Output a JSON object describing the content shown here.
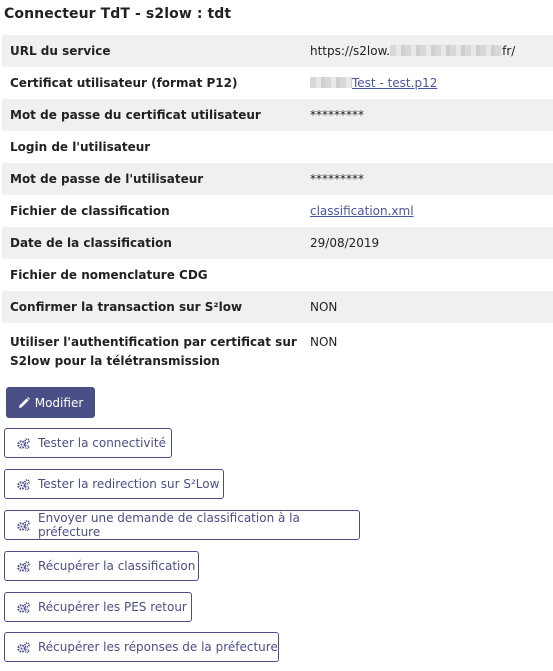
{
  "title": "Connecteur TdT - s2low : tdt",
  "rows": [
    {
      "label": "URL du service",
      "value_prefix": "https://s2low.",
      "value_suffix": "fr/"
    },
    {
      "label": "Certificat utilisateur (format P12)",
      "link": "Test - test.p12"
    },
    {
      "label": "Mot de passe du certificat utilisateur",
      "value": "*********"
    },
    {
      "label": "Login de l'utilisateur",
      "value": ""
    },
    {
      "label": "Mot de passe de l'utilisateur",
      "value": "*********"
    },
    {
      "label": "Fichier de classification",
      "link": "classification.xml"
    },
    {
      "label": "Date de la classification",
      "value": "29/08/2019"
    },
    {
      "label": "Fichier de nomenclature CDG",
      "value": ""
    },
    {
      "label": "Confirmer la transaction sur S²low",
      "value": "NON"
    },
    {
      "label": "Utiliser l'authentification par certificat sur S2low pour la télétransmission",
      "value": "NON"
    }
  ],
  "buttons": {
    "modifier": "Modifier",
    "tester_connectivite": "Tester la connectivité",
    "tester_redirection": "Tester la redirection sur S²Low",
    "envoyer_classification": "Envoyer une demande de classification à la préfecture",
    "recuperer_classification": "Récupérer la classification",
    "recuperer_pes": "Récupérer les PES retour",
    "recuperer_reponses": "Récupérer les réponses de la préfecture"
  },
  "colors": {
    "primary": "#4b4f87",
    "row_alt": "#f0f0f0",
    "link": "#4a56a0"
  },
  "icons": {
    "modifier": "pencil-icon",
    "actions": "cogs-icon"
  }
}
